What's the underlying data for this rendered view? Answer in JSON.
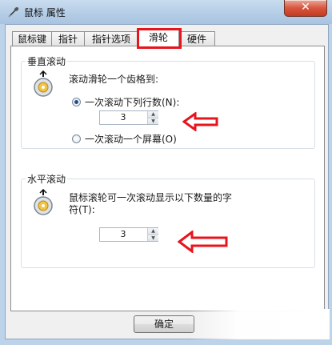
{
  "window": {
    "title": "鼠标 属性",
    "close_label": "✕"
  },
  "tabs": [
    {
      "label": "鼠标键"
    },
    {
      "label": "指针"
    },
    {
      "label": "指针选项"
    },
    {
      "label": "滑轮",
      "active": true
    },
    {
      "label": "硬件"
    }
  ],
  "vertical_group": {
    "title": "垂直滚动",
    "description": "滚动滑轮一个齿格到:",
    "option_lines": "一次滚动下列行数(N):",
    "lines_value": "3",
    "option_screen": "一次滚动一个屏幕(O)",
    "selected": "lines"
  },
  "horizontal_group": {
    "title": "水平滚动",
    "description_line1": "鼠标滚轮可一次滚动显示以下数量的字",
    "description_line2": "符(T):",
    "chars_value": "3"
  },
  "buttons": {
    "ok": "确定"
  },
  "colors": {
    "annotation_red": "#e8141d",
    "titlebar": "#b5cde6",
    "close": "#c43a22"
  }
}
